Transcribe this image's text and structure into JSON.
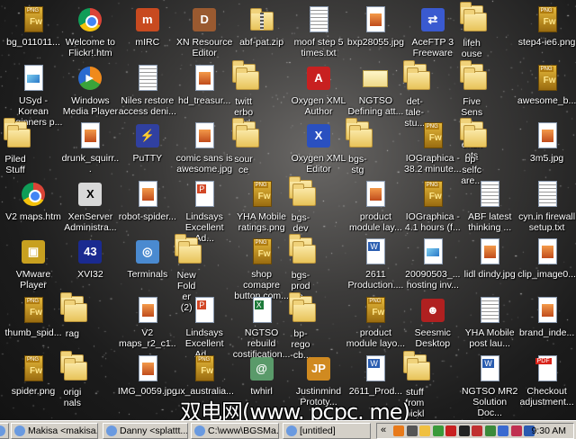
{
  "desktop": {
    "icons": [
      {
        "label": "bg_011011...",
        "type": "png"
      },
      {
        "label": "Welcome to Flickr!.htm",
        "type": "chrome"
      },
      {
        "label": "mIRC",
        "type": "app",
        "color": "#c84a20",
        "glyph": "m"
      },
      {
        "label": "XN Resource Editor",
        "type": "app",
        "color": "#9a5a30",
        "glyph": "D"
      },
      {
        "label": "abf-pat.zip",
        "type": "zip"
      },
      {
        "label": "moof step 5 times.txt",
        "type": "txt"
      },
      {
        "label": "bxp28055.jpg",
        "type": "jpg"
      },
      {
        "label": "AceFTP 3 Freeware",
        "type": "app",
        "color": "#3a5ad0",
        "glyph": "⇄"
      },
      {
        "label": "lifehouse-p...",
        "type": "folder"
      },
      {
        "label": "step4-ie6.png",
        "type": "png"
      },
      {
        "label": "USyd - Korean Beginners p...",
        "type": "doc"
      },
      {
        "label": "Windows Media Player",
        "type": "wmp"
      },
      {
        "label": "Niles restore access deni...",
        "type": "txt"
      },
      {
        "label": "hd_treasur...",
        "type": "jpg"
      },
      {
        "label": "twitterboard",
        "type": "folder"
      },
      {
        "label": "Oxygen XML Author",
        "type": "app",
        "color": "#c82020",
        "glyph": "A"
      },
      {
        "label": "NGTSO Defining att...",
        "type": "mail"
      },
      {
        "label": "det-tale-stu...",
        "type": "folder"
      },
      {
        "label": "Five Senses - Screenshots",
        "type": "folder"
      },
      {
        "label": "awesome_b...",
        "type": "png"
      },
      {
        "label": "Piled Stuff",
        "type": "folder"
      },
      {
        "label": "drunk_squirr...",
        "type": "jpg"
      },
      {
        "label": "PuTTY",
        "type": "app",
        "color": "#3040a0",
        "glyph": "⚡"
      },
      {
        "label": "comic sans is awesome.jpg",
        "type": "jpg"
      },
      {
        "label": "source",
        "type": "folder"
      },
      {
        "label": "Oxygen XML Editor",
        "type": "app",
        "color": "#2a50c0",
        "glyph": "X"
      },
      {
        "label": "bgs-stg",
        "type": "folder"
      },
      {
        "label": "IOGraphica - 38.2 minute...",
        "type": "png"
      },
      {
        "label": "bp-selfcare...",
        "type": "folder"
      },
      {
        "label": "3m5.jpg",
        "type": "jpg"
      },
      {
        "label": "V2 maps.htm",
        "type": "chrome"
      },
      {
        "label": "XenServer Administra...",
        "type": "app",
        "color": "#d8d8d8",
        "glyph": "X",
        "fg": "#000"
      },
      {
        "label": "robot-spider...",
        "type": "jpg"
      },
      {
        "label": "Lindsays Excellent Ad...",
        "type": "ppt"
      },
      {
        "label": "YHA Mobile ratings.png",
        "type": "png"
      },
      {
        "label": "bgs-dev",
        "type": "folder"
      },
      {
        "label": "product module lay...",
        "type": "jpg"
      },
      {
        "label": "IOGraphica - 4.1 hours (f...",
        "type": "png"
      },
      {
        "label": "ABF latest thinking ...",
        "type": "txt"
      },
      {
        "label": "cyn.in firewall setup.txt",
        "type": "txt"
      },
      {
        "label": "VMware Player",
        "type": "app",
        "color": "#c8a020",
        "glyph": "▣"
      },
      {
        "label": "XVI32",
        "type": "app",
        "color": "#1a2a90",
        "glyph": "43"
      },
      {
        "label": "Terminals",
        "type": "app",
        "color": "#4a8ad0",
        "glyph": "◎"
      },
      {
        "label": "New Folder (2)",
        "type": "folder"
      },
      {
        "label": "shop comapre button com...",
        "type": "png"
      },
      {
        "label": "bgs-prod-im...",
        "type": "folder"
      },
      {
        "label": "2611 Production....",
        "type": "word"
      },
      {
        "label": "20090503_... hosting inv...",
        "type": "doc"
      },
      {
        "label": "lidl dindy.jpg",
        "type": "jpg"
      },
      {
        "label": "clip_image0...",
        "type": "jpg"
      },
      {
        "label": "thumb_spid...",
        "type": "png"
      },
      {
        "label": "rag",
        "type": "folder"
      },
      {
        "label": "V2 maps_r2_c1...",
        "type": "jpg"
      },
      {
        "label": "Lindsays Excellent Ad...",
        "type": "ppt"
      },
      {
        "label": "NGTSO rebuild costification...",
        "type": "xls"
      },
      {
        "label": "bp-rego-cb...",
        "type": "folder"
      },
      {
        "label": "product module layo...",
        "type": "png"
      },
      {
        "label": "Seesmic Desktop",
        "type": "app",
        "color": "#b02020",
        "glyph": "☻"
      },
      {
        "label": "YHA Mobile post lau...",
        "type": "txt"
      },
      {
        "label": "brand_inde...",
        "type": "jpg"
      },
      {
        "label": "spider.png",
        "type": "png"
      },
      {
        "label": "originals",
        "type": "folder"
      },
      {
        "label": "IMG_0059.jpg",
        "type": "jpg"
      },
      {
        "label": "ux_australia...",
        "type": "png"
      },
      {
        "label": "twhirl",
        "type": "app",
        "color": "#5a9a6a",
        "glyph": "@"
      },
      {
        "label": "Justinmind Prototy...",
        "type": "app",
        "color": "#d08a20",
        "glyph": "JP"
      },
      {
        "label": "2611_Prod...",
        "type": "word"
      },
      {
        "label": "stuff from pickles",
        "type": "folder"
      },
      {
        "label": "NGTSO MR2 Solution Doc...",
        "type": "word"
      },
      {
        "label": "Checkout adjustment...",
        "type": "pdf"
      }
    ]
  },
  "watermark": "双电网(www. pcpc. me)",
  "taskbar": {
    "buttons": [
      {
        "label": "..."
      },
      {
        "label": "Makisa <makisa..."
      },
      {
        "label": "Danny <splattt..."
      },
      {
        "label": "C:\\www\\BGSMa..."
      },
      {
        "label": "[untitled]"
      }
    ],
    "tray_chevron": "«",
    "tray_icons": [
      {
        "name": "java-icon",
        "color": "#e87a1a"
      },
      {
        "name": "media-icon",
        "color": "#555"
      },
      {
        "name": "clock-app-icon",
        "color": "#f0c040"
      },
      {
        "name": "messenger-icon",
        "color": "#3a9a3a"
      },
      {
        "name": "acrobat-icon",
        "color": "#c82020"
      },
      {
        "name": "tool-icon",
        "color": "#222"
      },
      {
        "name": "calendar-icon",
        "color": "#c03030"
      },
      {
        "name": "update-icon",
        "color": "#3a8a3a"
      },
      {
        "name": "network-icon",
        "color": "#3a6ad0"
      },
      {
        "name": "heart-icon",
        "color": "#c03050"
      },
      {
        "name": "info-icon",
        "color": "#2a5ab0"
      }
    ],
    "clock": "9:30 AM"
  }
}
